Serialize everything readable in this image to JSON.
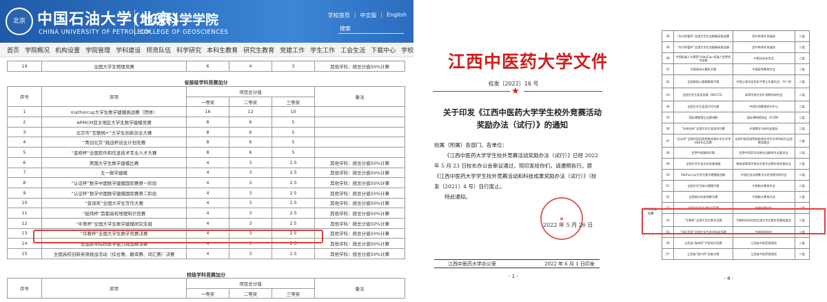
{
  "left": {
    "logo_text": "北京",
    "university_cn": "中国石油大学(北京)",
    "university_en": "CHINA UNIVERSITY OF PETROLEUM",
    "college_cn": "地球科学学院",
    "college_en": "COLLEGE OF GEOSCIENCES",
    "toplinks": [
      "学校首页",
      "中文版",
      "English"
    ],
    "search_placeholder": "搜索",
    "nav": [
      "首页",
      "学院概况",
      "机构设置",
      "学院管理",
      "学科建设",
      "师资队伍",
      "科学研究",
      "本科生教育",
      "研究生教育",
      "党建工作",
      "学生工作",
      "工会生活",
      "下载中心",
      "学校主页"
    ],
    "top_row": [
      "19",
      "全国大学生物理竞赛",
      "6",
      "4",
      "3",
      "其他学科：按总分值50%计算"
    ],
    "section1_title": "省部级学科竞赛加分",
    "header": {
      "seq": "序号",
      "award": "奖项",
      "total": "项目总分值",
      "first": "一等奖",
      "second": "二等奖",
      "third": "三等奖",
      "remark": "备注"
    },
    "rows": [
      [
        "1",
        "mathorcup大学生数学建模挑战赛（团体）",
        "16",
        "12",
        "10",
        ""
      ],
      [
        "2",
        "APMCM亚太地区大学生数学建模竞赛",
        "8",
        "6",
        "5",
        ""
      ],
      [
        "3",
        "北京市“互联网+”大学生创新创业大赛",
        "8",
        "6",
        "5",
        ""
      ],
      [
        "4",
        "“青创北京”挑战杯创业计划竞赛",
        "8",
        "6",
        "5",
        ""
      ],
      [
        "5",
        "“蓝桥杯”全国软件和信息技术专业人才大赛",
        "8",
        "6",
        "5",
        ""
      ],
      [
        "6",
        "美国大学生数学建模比赛",
        "4",
        "3",
        "2.5",
        "其他学科：按总分值50%计算"
      ],
      [
        "7",
        "五一数学建模",
        "4",
        "3",
        "2.5",
        "其他学科：按总分值50%计算"
      ],
      [
        "8",
        "“认证杯”数学中国数学建模国际赛第一阶段",
        "4",
        "3",
        "2.5",
        "其他学科：按总分值50%计算"
      ],
      [
        "9",
        "“认证杯”数学中国数学建模国际赛第二阶段",
        "4",
        "3",
        "2.5",
        "其他学科：按总分值50%计算"
      ],
      [
        "10",
        "“普译奖”全国大学生写作大赛",
        "4",
        "3",
        "2.5",
        "其他学科：按总分值50%计算"
      ],
      [
        "11",
        "“经纬杯”首都高校地理知识竞赛",
        "4",
        "3",
        "2.5",
        "其他学科：按总分值50%计算"
      ],
      [
        "12",
        "“中青杯”全国大学生数学建模研究生组",
        "4",
        "3",
        "2.5",
        "其他学科：按总分值50%计算"
      ],
      [
        "13",
        "“华教杯”全国大学生数学竞赛决赛",
        "4",
        "3",
        "2.5",
        "其他学科：按总分值50%计算"
      ],
      [
        "14",
        "全国高等院校数学能力挑战赛决赛",
        "4",
        "3",
        "2.5",
        "其他学科：按总分值50%计算"
      ],
      [
        "15",
        "全国高校创新英语挑战活动（综合赛、翻译赛、词汇赛）决赛",
        "4",
        "3",
        "2.5",
        "其他学科：按总分值50%计算"
      ]
    ],
    "section2_title": "校级学科竞赛加分",
    "header2": {
      "seq": "序号",
      "award": "奖项",
      "total": "项目总分值",
      "first": "一等奖",
      "second": "二等奖",
      "third": "三等奖",
      "remark": "备注"
    }
  },
  "middle": {
    "title": "江西中医药大学文件",
    "doc_no": "校发〔2022〕16 号",
    "star": "★",
    "heading": "关于印发《江西中医药大学学生校外竞赛活动奖励办法（试行）》的通知",
    "salutation": "校属（附属）各部门、各单位：",
    "body": "《江西中医药大学学生校外竞赛活动奖励办法（试行）》已经 2022 年 5 月 23 日校长办公会审议通过，现印发给你们，请遵照执行。原《江西中医药大学学生校外竞赛活动和科技成果奖励办法（试行）》（校发〔2021〕4 号）自行废止。",
    "closing": "特此通知。",
    "seal_text": "江西中医药大学",
    "date": "2022 年 5 月 26 日",
    "footer_left": "江西中医药大学办公室",
    "footer_right": "2022 年 6 月 1 日印发",
    "page": "- 1 -"
  },
  "right": {
    "rows": [
      [
        "38",
        "“东方财富杯”全国大学生金融精英挑战赛",
        "团中央青年发展部",
        "二类"
      ],
      [
        "39",
        "“东方财富杯”全国大学生金融精英挑战赛",
        "团中央青年发展部",
        "二类"
      ],
      [
        "40",
        "中国机器人大赛暨 RoboCup 机器人世界杯中国赛",
        "中国自动化学会",
        "二类"
      ],
      [
        "41",
        "中国高校计算机大赛",
        "中国高等教育学会",
        "二类"
      ],
      [
        "42",
        "全国高校心理情景剧大赛",
        "中国心理学会危机干预工作委员会、中广网",
        "二类"
      ],
      [
        "43",
        "全国大学生英语竞赛（NECCS）",
        "高等学校大学外语教学研究会",
        "二类"
      ],
      [
        "44",
        "全国大学生英语写作大赛",
        "中国外语教育研究中心",
        "二类"
      ],
      [
        "45",
        "国际博物馆日志愿讲解",
        "国际博物馆协会（ICOM）",
        "二类"
      ],
      [
        "46",
        "“外研社杯”全国大学生英语系列赛",
        "外语教学与研究出版社",
        "二类"
      ],
      [
        "47",
        "“远志杯”全国中医药高等院校青年学生学术科研作品竞赛",
        "全国中医药高等院校青年学生学术科研作品竞赛组委会",
        "二类"
      ],
      [
        "48",
        "世界中医翻译大赛",
        "世界中医药学会联合会翻译专业委员会",
        "二类"
      ],
      [
        "49",
        "全国大学生化学实验邀请赛",
        "教育部高等学校化学类专业教学指导委员会",
        "二类"
      ],
      [
        "50",
        "Mathorcup大学生数学建模挑战赛",
        "中国优选法统筹法与经济数学研究会",
        "二类"
      ],
      [
        "51",
        "全国大学生统计建模大赛",
        "中国统计教育学会",
        "二类"
      ],
      [
        "52",
        "全国统计科普讲解大赛",
        "中国统计教育学会",
        "二类"
      ],
      [
        "53",
        "全国大学生生命科学竞赛",
        "中国生物学会",
        "二类"
      ],
      [
        "54",
        "“华教杯”全国大学生数学竞赛",
        "华教科学研究院全国大学生数学竞赛组委会",
        "二类"
      ],
      [
        "55",
        "“吴阶平杯”全国大学生医学科技竞赛",
        "中国医师协会",
        "二类"
      ],
      [
        "56",
        "江西省“香林杯”中医知识竞赛",
        "江西省中医药管理局",
        "二类"
      ],
      [
        "57",
        "江西省“振兴杯”技能大赛",
        "江西省中医药管理局",
        "二类"
      ]
    ],
    "category_label": "学术科技竞赛",
    "page": "- 8 -"
  },
  "colors": {
    "banner": "#2f73c4",
    "highlight": "#e23b3b",
    "doc_red": "#d0201c"
  }
}
